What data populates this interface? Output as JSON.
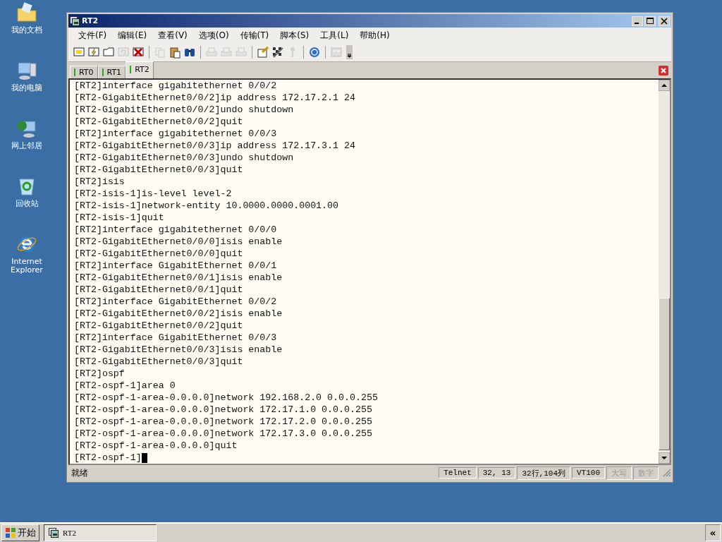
{
  "desktop_icons": [
    {
      "label": "我的文档",
      "kind": "folder"
    },
    {
      "label": "我的电脑",
      "kind": "computer"
    },
    {
      "label": "网上邻居",
      "kind": "network"
    },
    {
      "label": "回收站",
      "kind": "recycle"
    },
    {
      "label": "Internet Explorer",
      "kind": "browser"
    }
  ],
  "window": {
    "title": "RT2"
  },
  "menu": [
    "文件(F)",
    "编辑(E)",
    "查看(V)",
    "选项(O)",
    "传输(T)",
    "脚本(S)",
    "工具(L)",
    "帮助(H)"
  ],
  "toolbar": [
    {
      "kind": "connect",
      "disabled": false
    },
    {
      "kind": "quick",
      "disabled": false
    },
    {
      "kind": "tab",
      "disabled": false
    },
    {
      "kind": "reconnect",
      "disabled": true
    },
    {
      "kind": "disconnect",
      "disabled": false
    },
    {
      "kind": "sep"
    },
    {
      "kind": "copy",
      "disabled": true
    },
    {
      "kind": "paste",
      "disabled": false
    },
    {
      "kind": "find",
      "disabled": false
    },
    {
      "kind": "sep"
    },
    {
      "kind": "print",
      "disabled": true
    },
    {
      "kind": "print",
      "disabled": true
    },
    {
      "kind": "print",
      "disabled": true
    },
    {
      "kind": "sep"
    },
    {
      "kind": "options",
      "disabled": false
    },
    {
      "kind": "global",
      "disabled": false
    },
    {
      "kind": "key",
      "disabled": true
    },
    {
      "kind": "sep"
    },
    {
      "kind": "help",
      "disabled": false
    },
    {
      "kind": "sep"
    },
    {
      "kind": "map",
      "disabled": true
    }
  ],
  "tabs": [
    {
      "label": "RT0",
      "selected": false
    },
    {
      "label": "RT1",
      "selected": false
    },
    {
      "label": "RT2",
      "selected": true
    }
  ],
  "terminal_lines": [
    "[RT2]interface gigabitethernet 0/0/2",
    "[RT2-GigabitEthernet0/0/2]ip address 172.17.2.1 24",
    "[RT2-GigabitEthernet0/0/2]undo shutdown",
    "[RT2-GigabitEthernet0/0/2]quit",
    "[RT2]interface gigabitethernet 0/0/3",
    "[RT2-GigabitEthernet0/0/3]ip address 172.17.3.1 24",
    "[RT2-GigabitEthernet0/0/3]undo shutdown",
    "[RT2-GigabitEthernet0/0/3]quit",
    "[RT2]isis",
    "[RT2-isis-1]is-level level-2",
    "[RT2-isis-1]network-entity 10.0000.0000.0001.00",
    "[RT2-isis-1]quit",
    "[RT2]interface gigabitethernet 0/0/0",
    "[RT2-GigabitEthernet0/0/0]isis enable",
    "[RT2-GigabitEthernet0/0/0]quit",
    "[RT2]interface GigabitEthernet 0/0/1",
    "[RT2-GigabitEthernet0/0/1]isis enable",
    "[RT2-GigabitEthernet0/0/1]quit",
    "[RT2]interface GigabitEthernet 0/0/2",
    "[RT2-GigabitEthernet0/0/2]isis enable",
    "[RT2-GigabitEthernet0/0/2]quit",
    "[RT2]interface GigabitEthernet 0/0/3",
    "[RT2-GigabitEthernet0/0/3]isis enable",
    "[RT2-GigabitEthernet0/0/3]quit",
    "[RT2]ospf",
    "[RT2-ospf-1]area 0",
    "[RT2-ospf-1-area-0.0.0.0]network 192.168.2.0 0.0.0.255",
    "[RT2-ospf-1-area-0.0.0.0]network 172.17.1.0 0.0.0.255",
    "[RT2-ospf-1-area-0.0.0.0]network 172.17.2.0 0.0.0.255",
    "[RT2-ospf-1-area-0.0.0.0]network 172.17.3.0 0.0.0.255",
    "[RT2-ospf-1-area-0.0.0.0]quit",
    "[RT2-ospf-1]"
  ],
  "status_bar": {
    "message": "就绪",
    "panes": [
      {
        "text": "Telnet",
        "disabled": false
      },
      {
        "text": "32,  13",
        "disabled": false
      },
      {
        "text": "32行,104列",
        "disabled": false
      },
      {
        "text": "VT100",
        "disabled": false
      },
      {
        "text": "大写",
        "disabled": true
      },
      {
        "text": "数字",
        "disabled": true
      }
    ]
  },
  "taskbar": {
    "start": "开始",
    "tasks": [
      {
        "label": "RT2"
      }
    ],
    "tray_toggle": "«"
  }
}
